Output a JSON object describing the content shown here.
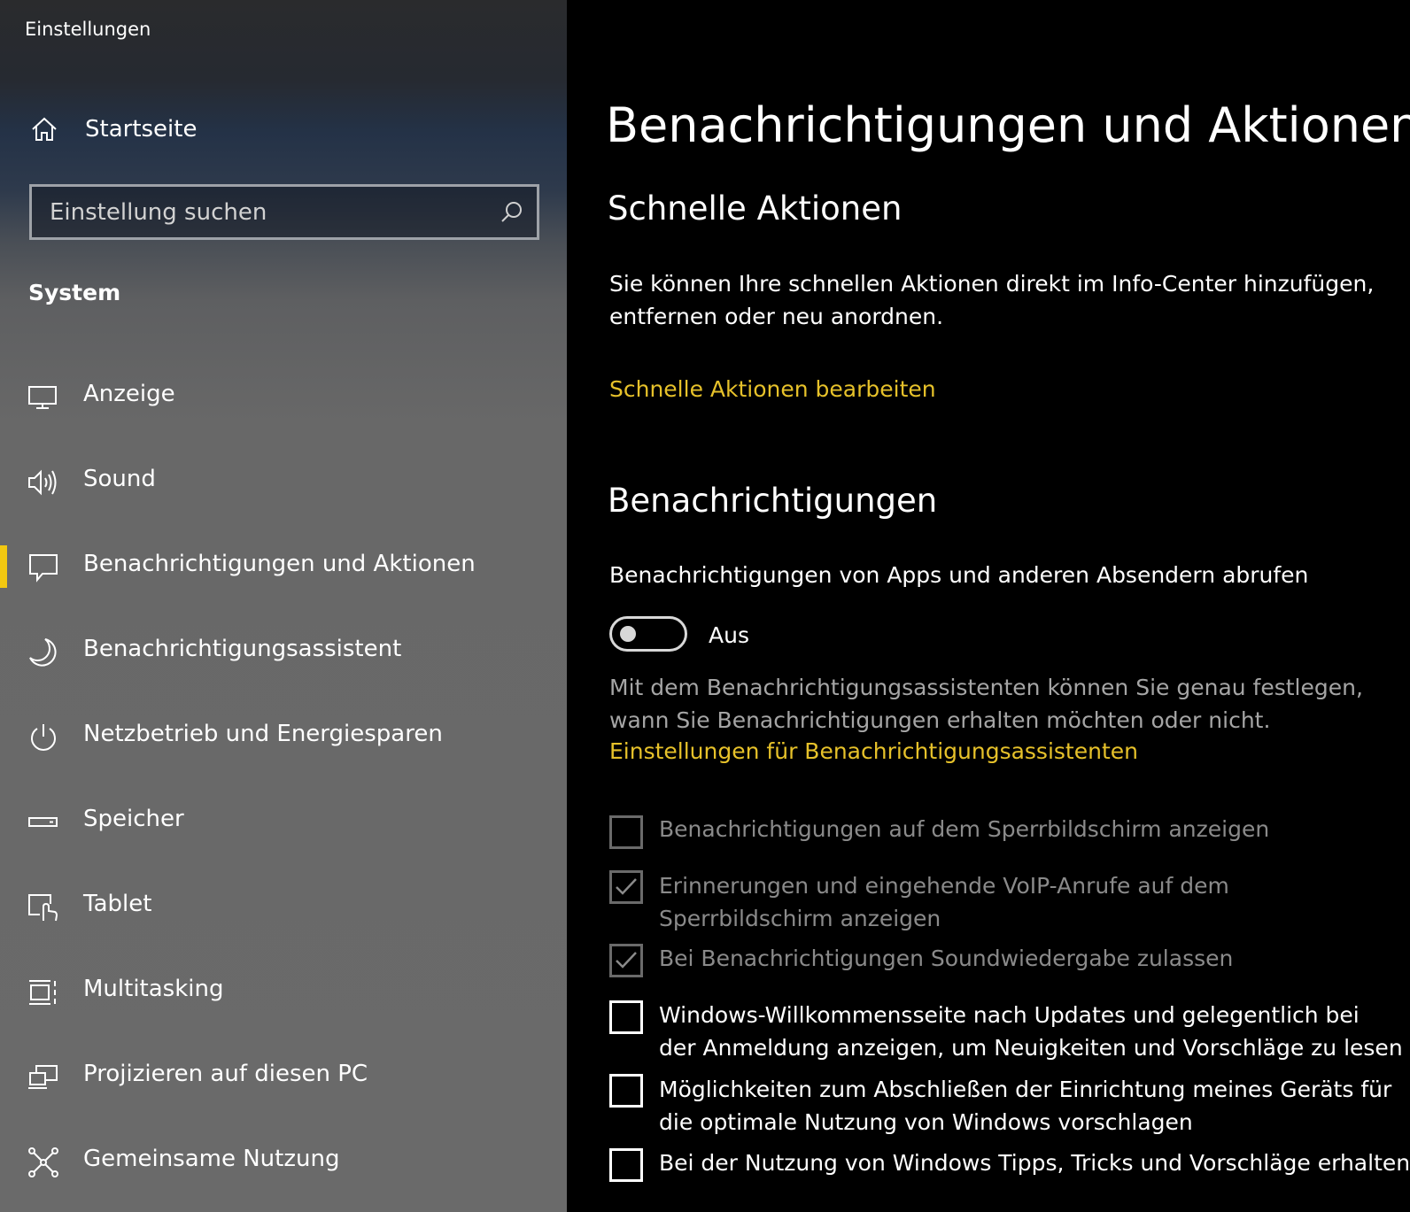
{
  "window": {
    "title": "Einstellungen"
  },
  "sidebar": {
    "home_label": "Startseite",
    "search": {
      "placeholder": "Einstellung suchen",
      "value": ""
    },
    "section": "System",
    "items": [
      {
        "label": "Anzeige",
        "icon": "monitor-icon",
        "active": false
      },
      {
        "label": "Sound",
        "icon": "speaker-icon",
        "active": false
      },
      {
        "label": "Benachrichtigungen und Aktionen",
        "icon": "notification-icon",
        "active": true
      },
      {
        "label": "Benachrichtigungsassistent",
        "icon": "moon-icon",
        "active": false
      },
      {
        "label": "Netzbetrieb und Energiesparen",
        "icon": "power-icon",
        "active": false
      },
      {
        "label": "Speicher",
        "icon": "storage-icon",
        "active": false
      },
      {
        "label": "Tablet",
        "icon": "tablet-icon",
        "active": false
      },
      {
        "label": "Multitasking",
        "icon": "multitasking-icon",
        "active": false
      },
      {
        "label": "Projizieren auf diesen PC",
        "icon": "project-icon",
        "active": false
      },
      {
        "label": "Gemeinsame Nutzung",
        "icon": "share-icon",
        "active": false
      }
    ]
  },
  "main": {
    "title": "Benachrichtigungen und Aktionen",
    "quick_actions": {
      "heading": "Schnelle Aktionen",
      "description": "Sie können Ihre schnellen Aktionen direkt im Info-Center hinzufügen, entfernen oder neu anordnen.",
      "link": "Schnelle Aktionen bearbeiten"
    },
    "notifications": {
      "heading": "Benachrichtigungen",
      "toggle_label": "Benachrichtigungen von Apps und anderen Absendern abrufen",
      "toggle_state": "Aus",
      "toggle_on": false,
      "assistant_text": "Mit dem Benachrichtigungsassistenten können Sie genau festlegen, wann Sie Benachrichtigungen erhalten möchten oder nicht.",
      "assistant_link": "Einstellungen für Benachrichtigungsassistenten",
      "checkboxes": [
        {
          "label": "Benachrichtigungen auf dem Sperrbildschirm anzeigen",
          "checked": false,
          "disabled": true
        },
        {
          "label": "Erinnerungen und eingehende VoIP-Anrufe auf dem Sperrbildschirm anzeigen",
          "checked": true,
          "disabled": true
        },
        {
          "label": "Bei Benachrichtigungen Soundwiedergabe zulassen",
          "checked": true,
          "disabled": true
        },
        {
          "label": "Windows-Willkommensseite nach Updates und gelegentlich bei der Anmeldung anzeigen, um Neuigkeiten und Vorschläge zu lesen",
          "checked": false,
          "disabled": false
        },
        {
          "label": "Möglichkeiten zum Abschließen der Einrichtung meines Geräts für die optimale Nutzung von Windows vorschlagen",
          "checked": false,
          "disabled": false
        },
        {
          "label": "Bei der Nutzung von Windows Tipps, Tricks und Vorschläge erhalten",
          "checked": false,
          "disabled": false
        }
      ]
    }
  },
  "colors": {
    "accent": "#f2c811",
    "link": "#e6c12a",
    "background": "#000000"
  }
}
